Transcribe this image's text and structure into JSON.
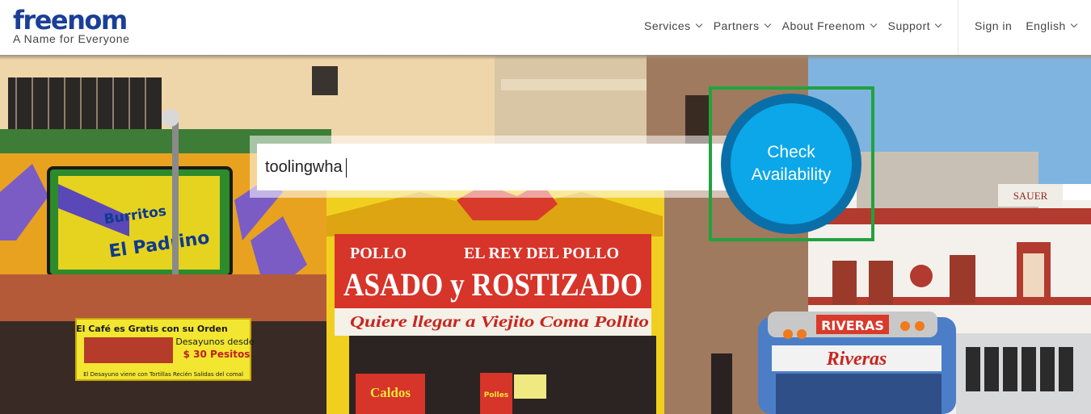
{
  "header": {
    "logo_text": "freenom",
    "tagline": "A Name for Everyone",
    "nav": [
      {
        "label": "Services"
      },
      {
        "label": "Partners"
      },
      {
        "label": "About Freenom"
      },
      {
        "label": "Support"
      }
    ],
    "sign_in": "Sign in",
    "language": "English"
  },
  "search": {
    "value": "toolingwha",
    "button_line1": "Check",
    "button_line2": "Availability"
  },
  "scene_signs": {
    "burritos_1": "Burritos",
    "burritos_2": "El Padrino",
    "cafe_1": "El Café es Gratis con su Orden",
    "cafe_2": "Desayunos desde",
    "cafe_3": "$ 30 Pesitos",
    "cafe_4": "El Desayuno viene con Tortillas Recién Salidas del comal",
    "pollo_top_left": "POLLO",
    "pollo_top_right": "EL REY DEL POLLO",
    "pollo_main": "ASADO y ROSTIZADO",
    "pollo_sub": "Quiere llegar a Viejito Coma Pollito",
    "caldos": "Caldos",
    "polles": "Polles",
    "sauer": "SAUER",
    "bus_top": "RIVERAS",
    "bus_script": "Riveras"
  },
  "colors": {
    "brand_blue": "#1b3f97",
    "button_blue": "#0ba7e8",
    "button_ring": "#0a6fa8",
    "highlight_green": "#22a23f"
  }
}
